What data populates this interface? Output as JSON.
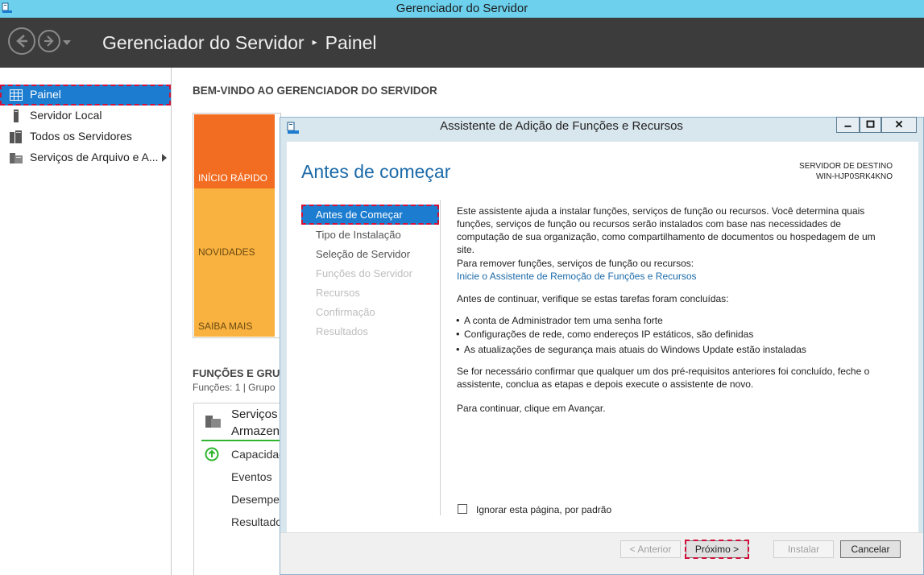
{
  "window": {
    "title": "Gerenciador do Servidor"
  },
  "header": {
    "breadcrumb_root": "Gerenciador do Servidor",
    "breadcrumb_sep": "▸",
    "breadcrumb_current": "Painel"
  },
  "sidebar": {
    "items": [
      {
        "label": "Painel",
        "icon": "dashboard-icon",
        "selected": true
      },
      {
        "label": "Servidor Local",
        "icon": "server-icon"
      },
      {
        "label": "Todos os Servidores",
        "icon": "servers-icon"
      },
      {
        "label": "Serviços de Arquivo e A...",
        "icon": "file-services-icon",
        "has_submenu": true
      }
    ]
  },
  "dashboard": {
    "welcome": "BEM-VINDO AO GERENCIADOR DO SERVIDOR",
    "tiles": [
      "INÍCIO RÁPIDO",
      "NOVIDADES",
      "SAIBA MAIS"
    ],
    "roles_title": "FUNÇÕES E GRU",
    "roles_sub": "Funções: 1 | Grupo",
    "role_name_1": "Serviços",
    "role_name_2": "Armazen",
    "role_lines": [
      "Capacidad",
      "Eventos",
      "Desempe",
      "Resultado"
    ]
  },
  "dialog": {
    "title": "Assistente de Adição de Funções e Recursos",
    "heading": "Antes de começar",
    "dest_label": "SERVIDOR DE DESTINO",
    "dest_server": "WIN-HJP0SRK4KNO",
    "steps": [
      "Antes de Começar",
      "Tipo de Instalação",
      "Seleção de Servidor",
      "Funções do Servidor",
      "Recursos",
      "Confirmação",
      "Resultados"
    ],
    "para1": "Este assistente ajuda a instalar funções, serviços de função ou recursos. Você determina quais funções, serviços de função ou recursos serão instalados com base nas necessidades de computação de sua organização, como compartilhamento de documentos ou hospedagem de um site.",
    "para2": "Para remover funções, serviços de função ou recursos:",
    "link": "Inicie o Assistente de Remoção de Funções e Recursos",
    "para3": "Antes de continuar, verifique se estas tarefas foram concluídas:",
    "bullets": [
      "A conta de Administrador tem uma senha forte",
      "Configurações de rede, como endereços IP estáticos, são definidas",
      "As atualizações de segurança mais atuais do Windows Update estão instaladas"
    ],
    "para4": "Se for necessário confirmar que qualquer um dos pré-requisitos anteriores foi concluído, feche o assistente, conclua as etapas e depois execute o assistente de novo.",
    "para5": "Para continuar, clique em Avançar.",
    "skip_label": "Ignorar esta página, por padrão",
    "buttons": {
      "prev": "< Anterior",
      "next": "Próximo >",
      "install": "Instalar",
      "cancel": "Cancelar"
    }
  },
  "colors": {
    "titlebar": "#6dd1ee",
    "header": "#3c3c3c",
    "accent": "#1c7ccf",
    "quick_tile": "#f26c21",
    "tile": "#f9b23f",
    "highlight_outline": "#d0103a"
  }
}
